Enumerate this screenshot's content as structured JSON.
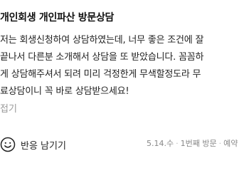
{
  "review": {
    "title": "개인회생 개인파산 방문상담",
    "body_lines": [
      "저는 회생신청하여 상담하였는데, 너무 좋은 조건에 잘",
      "끝나서 다른분 소개해서 상담을 또 받았습니다. 꼼꼼하",
      "게 상담해주셔서 되려 미리 걱정한게 무색할정도라 무",
      "료상담이니 꼭 바로 상담받으세요!"
    ],
    "fold_label": "접기"
  },
  "footer": {
    "reaction_label": "반응 남기기",
    "reaction_icon": "smile-icon",
    "date": "5.14.수",
    "visit": "1번째 방문",
    "booking": "예약"
  }
}
